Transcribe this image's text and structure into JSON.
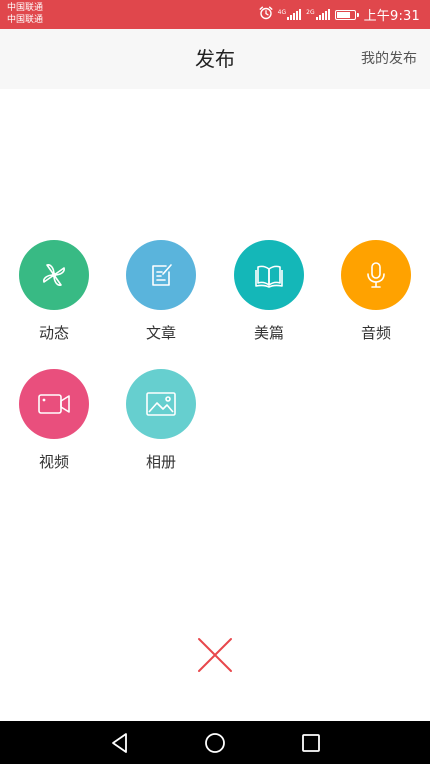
{
  "status_bar": {
    "carrier_1": "中国联通",
    "carrier_2": "中国联通",
    "sim1_network": "4G",
    "sim2_network": "2G",
    "time": "上午9:31",
    "battery_level": 0.85,
    "bar_color": "#e0474c",
    "icons": [
      "alarm-icon",
      "signal-icon",
      "battery-icon"
    ]
  },
  "header": {
    "title": "发布",
    "action_label": "我的发布"
  },
  "publish_options": [
    {
      "label": "动态",
      "icon": "pinwheel-icon",
      "color": "#38ba84"
    },
    {
      "label": "文章",
      "icon": "edit-note-icon",
      "color": "#5ab4dc"
    },
    {
      "label": "美篇",
      "icon": "open-book-icon",
      "color": "#14b7b8"
    },
    {
      "label": "音频",
      "icon": "microphone-icon",
      "color": "#ffa200"
    },
    {
      "label": "视频",
      "icon": "video-camera-icon",
      "color": "#e94f7d"
    },
    {
      "label": "相册",
      "icon": "image-icon",
      "color": "#66cfcf"
    }
  ],
  "close": {
    "icon": "close-icon",
    "color": "#e8474c"
  },
  "nav_bar": {
    "icons": [
      "back-triangle-icon",
      "home-circle-icon",
      "recents-square-icon"
    ]
  }
}
